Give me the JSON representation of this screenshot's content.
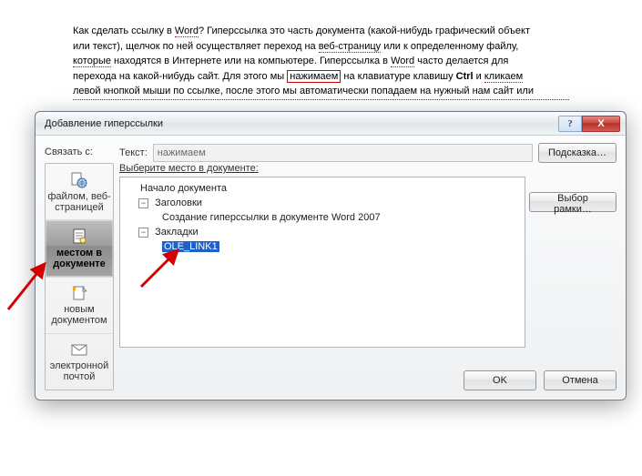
{
  "doc_text": {
    "l1a": "Как сделать ссылку в ",
    "l1b": "Word",
    "l1c": "? Гиперссылка это часть документа (какой-нибудь графический объект",
    "l2a": "или текст), щелчок по ней осуществляет переход на ",
    "l2b": "веб-страницу",
    "l2c": " или к определенному файлу,",
    "l3a": "которые",
    "l3b": " находятся в Интернете или на компьютере. Гиперссылка в ",
    "l3c": "Word",
    "l3d": " часто делается  для",
    "l4a": "перехода на какой-нибудь сайт. Для этого мы ",
    "l4b": "нажимаем",
    "l4c": " на клавиатуре клавишу ",
    "l4d": "Ctrl",
    "l4e": " и ",
    "l4f": "кликаем",
    "l5": "левой кнопкой мыши по ссылке, после этого мы автоматически попадаем на нужный нам сайт или"
  },
  "dialog": {
    "title": "Добавление гиперссылки",
    "help": "?",
    "close": "X",
    "link_with": "Связать с:",
    "text_lbl": "Текст:",
    "text_val": "нажимаем",
    "hint_btn": "Подсказка…",
    "choose_lbl": "Выберите место в документе:",
    "frame_btn": "Выбор рамки…",
    "ok": "OK",
    "cancel": "Отмена",
    "sidebar": [
      "файлом, веб-страницей",
      "местом в документе",
      "новым документом",
      "электронной почтой"
    ],
    "tree": {
      "root": "Начало документа",
      "headings": "Заголовки",
      "heading_item": "Создание гиперссылки в документе Word 2007",
      "bookmarks": "Закладки",
      "bookmark_sel": "OLE_LINK1"
    }
  }
}
